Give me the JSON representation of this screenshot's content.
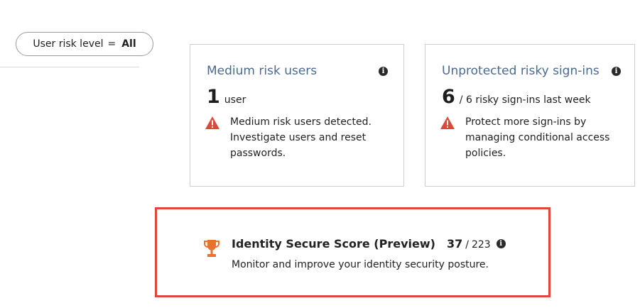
{
  "filter": {
    "label": "User risk level",
    "equals": "=",
    "value": "All"
  },
  "tiles": [
    {
      "title": "Medium risk users",
      "info_glyph": "i",
      "metric": "1",
      "metric_unit": "user",
      "warning_icon": "warning-triangle-icon",
      "warning_text": "Medium risk users detected. Investigate users and reset passwords."
    },
    {
      "title": "Unprotected risky sign-ins",
      "info_glyph": "i",
      "metric": "6",
      "metric_unit": "/ 6 risky sign-ins last week",
      "warning_icon": "warning-triangle-icon",
      "warning_text": "Protect more sign-ins by managing conditional access policies."
    }
  ],
  "secure_score": {
    "icon": "trophy-icon",
    "title": "Identity Secure Score (Preview)",
    "score": "37",
    "separator": "/",
    "total": "223",
    "info_glyph": "i",
    "description": "Monitor and improve your identity security posture."
  },
  "colors": {
    "title_blue": "#4a6a8f",
    "warning_red": "#e0473a",
    "trophy_orange": "#e8732c",
    "highlight_border": "#e0473a"
  }
}
